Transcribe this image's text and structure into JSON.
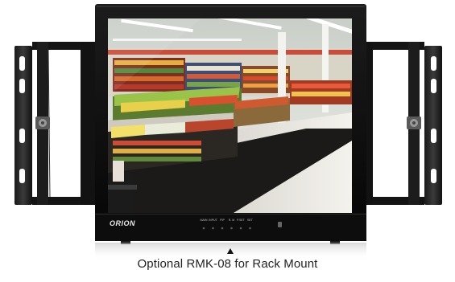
{
  "brand": {
    "logo_text": "ORION"
  },
  "monitor": {
    "button_labels": [
      "MAIN",
      "INPUT",
      "PIP",
      "R. M",
      "P.SET",
      "SET"
    ]
  },
  "caption": {
    "text": "Optional RMK-08 for Rack Mount"
  }
}
